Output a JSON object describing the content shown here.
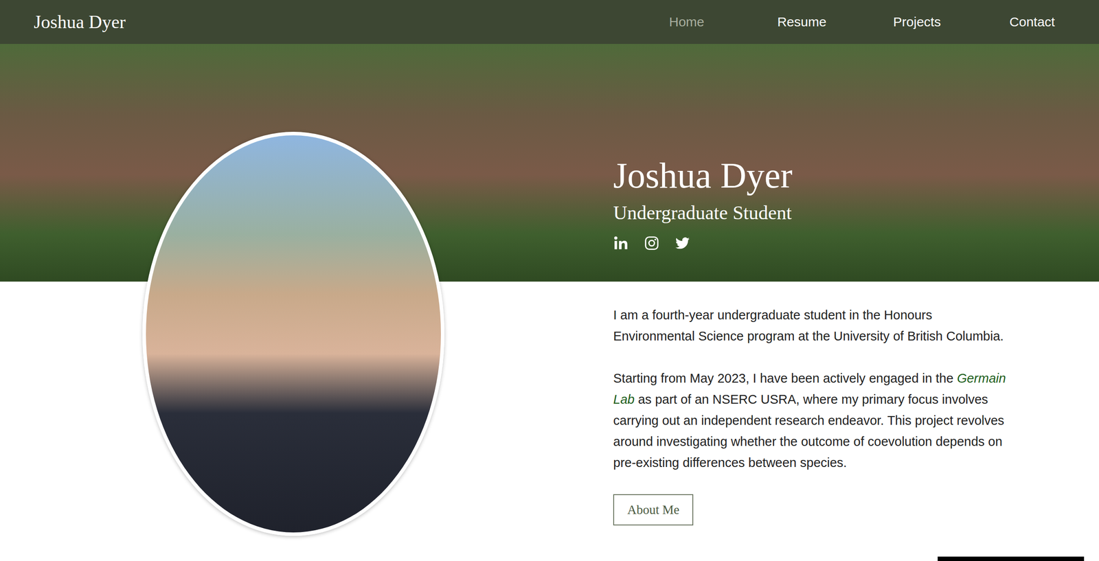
{
  "site_title": "Joshua Dyer",
  "nav": [
    {
      "label": "Home",
      "selected": true
    },
    {
      "label": "Resume",
      "selected": false
    },
    {
      "label": "Projects",
      "selected": false
    },
    {
      "label": "Contact",
      "selected": false
    }
  ],
  "hero": {
    "name": "Joshua Dyer",
    "subtitle": "Undergraduate Student"
  },
  "about": {
    "paragraph1": "I am a fourth-year undergraduate student in the Honours Environmental Science program at the University of British Columbia.",
    "paragraph2": {
      "before": "Starting from May 2023, I have been actively engaged in the ",
      "link": "Germain Lab",
      "after": " as part of an NSERC USRA, where my primary focus involves carrying out an independent research endeavor. This project revolves around investigating whether the outcome of coevolution depends on pre-existing differences between species."
    },
    "button": "About Me"
  }
}
